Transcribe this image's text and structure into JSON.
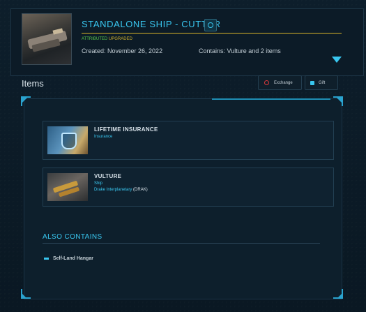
{
  "header": {
    "title": "STANDALONE SHIP - CUTTER",
    "tag_attributed": "ATTRIBUTED",
    "tag_upgraded": "UPGRADED",
    "created": "Created: November 26, 2022",
    "contains": "Contains: Vulture and 2 items"
  },
  "items_section": {
    "label": "Items",
    "exchange_label": "Exchange",
    "gift_label": "Gift"
  },
  "items": [
    {
      "name": "LIFETIME INSURANCE",
      "type": "Insurance"
    },
    {
      "name": "VULTURE",
      "type": "Ship",
      "manufacturer": "Drake Interplanetary",
      "manufacturer_code": "(DRAK)"
    }
  ],
  "also_contains": {
    "label": "ALSO CONTAINS",
    "items": [
      "Self-Land Hangar"
    ]
  },
  "colors": {
    "accent": "#39c7f0",
    "gold_rule": "#d8b329",
    "attributed": "#58c84b",
    "upgraded": "#d1b22c",
    "exchange_icon": "#d8383a"
  },
  "icons": [
    "ship-thumbnail",
    "pledge-icon",
    "collapse-arrow-icon",
    "exchange-icon",
    "gift-icon",
    "insurance-shield-icon",
    "vulture-ship-thumbnail",
    "bullet-icon"
  ]
}
